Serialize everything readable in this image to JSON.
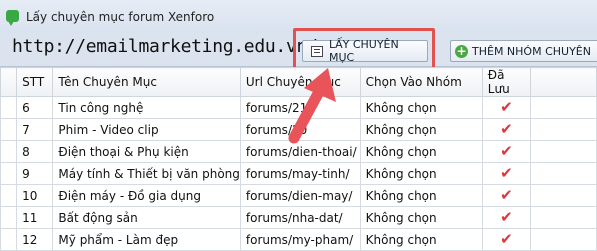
{
  "window": {
    "title": "Lấy chuyên mục forum Xenforo"
  },
  "toolbar": {
    "url": "http://emailmarketing.edu.vn/",
    "load_button": "LẤY CHUYÊN MỤC",
    "add_group_button": "THÊM NHÓM CHUYÊN"
  },
  "table": {
    "columns": [
      "STT",
      "Tên Chuyên Mục",
      "Url Chuyên Mục",
      "Chọn Vào Nhóm",
      "Đã Lưu"
    ],
    "rows": [
      {
        "stt": "6",
        "name": "Tin công nghệ",
        "url": "forums/21/",
        "group": "Không chọn",
        "saved": "✔"
      },
      {
        "stt": "7",
        "name": "Phim - Video clip",
        "url": "forums/20",
        "group": "Không chọn",
        "saved": "✔"
      },
      {
        "stt": "8",
        "name": "Điện thoại & Phụ kiện",
        "url": "forums/dien-thoai/",
        "group": "Không chọn",
        "saved": "✔"
      },
      {
        "stt": "9",
        "name": "Máy tính & Thiết bị văn phòng",
        "url": "forums/may-tinh/",
        "group": "Không chọn",
        "saved": "✔"
      },
      {
        "stt": "10",
        "name": "Điện máy - Đồ gia dụng",
        "url": "forums/dien-may/",
        "group": "Không chọn",
        "saved": "✔"
      },
      {
        "stt": "11",
        "name": "Bất động sản",
        "url": "forums/nha-dat/",
        "group": "Không chọn",
        "saved": "✔"
      },
      {
        "stt": "12",
        "name": "Mỹ phẩm - Làm đẹp",
        "url": "forums/my-pham/",
        "group": "Không chọn",
        "saved": "✔"
      }
    ]
  },
  "colors": {
    "highlight": "#e05250",
    "check": "#e3343a",
    "accent_green": "#3aa845"
  }
}
